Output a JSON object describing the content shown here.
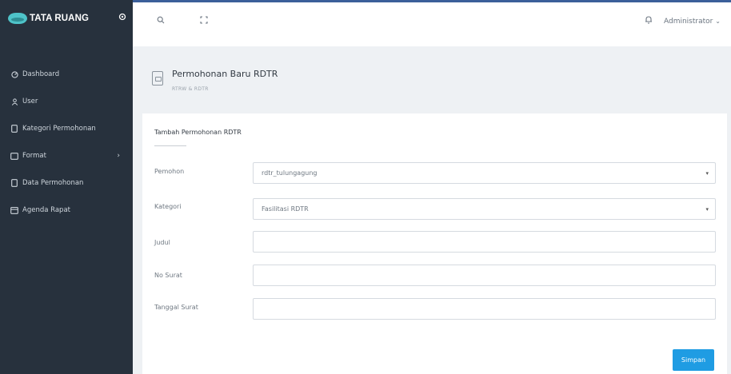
{
  "sidebar": {
    "brand": "TATA RUANG",
    "toggle_icon": "collapse-icon",
    "items": [
      {
        "label": "Dashboard",
        "icon": "dashboard-icon"
      },
      {
        "label": "User",
        "icon": "user-icon"
      },
      {
        "label": "Kategori Permohonan",
        "icon": "file-icon"
      },
      {
        "label": "Format",
        "icon": "folder-icon",
        "has_submenu": true
      },
      {
        "label": "Data Permohonan",
        "icon": "file-icon"
      },
      {
        "label": "Agenda Rapat",
        "icon": "calendar-icon"
      }
    ]
  },
  "topbar": {
    "search_icon": "search-icon",
    "fullscreen_icon": "fullscreen-icon",
    "notification_icon": "bell-icon",
    "user_name": "Administrator"
  },
  "page": {
    "title": "Permohonan Baru RDTR",
    "subtitle": "RTRW & RDTR"
  },
  "form": {
    "title": "Tambah Permohonan RDTR",
    "fields": [
      {
        "label": "Pemohon",
        "value": "rdtr_tulungagung",
        "type": "select"
      },
      {
        "label": "Kategori",
        "value": "Fasilitasi RDTR",
        "type": "select"
      },
      {
        "label": "Judul",
        "value": "",
        "type": "text"
      },
      {
        "label": "No Surat",
        "value": "",
        "type": "text"
      },
      {
        "label": "Tanggal Surat",
        "value": "",
        "type": "text"
      }
    ],
    "submit_label": "Simpan"
  },
  "colors": {
    "sidebar_bg": "#27313d",
    "accent": "#1f9ce3",
    "top_border": "#3b5f9a"
  }
}
